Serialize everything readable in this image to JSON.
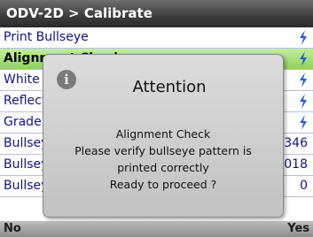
{
  "header": {
    "title": "ODV-2D > Calibrate"
  },
  "menu": {
    "items": [
      {
        "label": "Print Bullseye",
        "value": ""
      },
      {
        "label": "Alignment Check",
        "value": ""
      },
      {
        "label": "White",
        "value": ""
      },
      {
        "label": "Reflectance",
        "value": ""
      },
      {
        "label": "Grade",
        "value": ""
      },
      {
        "label": "Bullseye",
        "value": "346"
      },
      {
        "label": "Bullseye",
        "value": "018"
      },
      {
        "label": "Bullseye Slope",
        "value": "0"
      }
    ]
  },
  "dialog": {
    "title": "Attention",
    "icon": "info-icon",
    "lines": [
      "Alignment Check",
      "Please verify bullseye pattern is",
      "printed correctly",
      "Ready to proceed ?"
    ]
  },
  "softkeys": {
    "left": "No",
    "right": "Yes"
  },
  "colors": {
    "selected_row": "#8fd15e",
    "item_text": "#12128a",
    "bolt": "#1f5fd6"
  }
}
